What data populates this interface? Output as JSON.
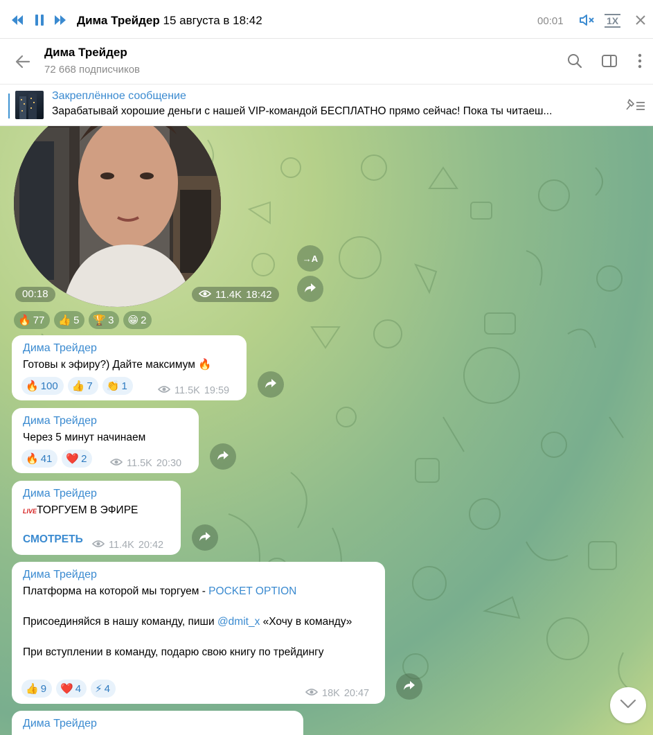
{
  "player": {
    "title_name": "Дима Трейдер",
    "title_date": "15 августа в 18:42",
    "time": "00:01",
    "speed": "1X"
  },
  "header": {
    "name": "Дима Трейдер",
    "subscribers": "72 668 подписчиков"
  },
  "pinned": {
    "title": "Закреплённое сообщение",
    "text_bold": "Зарабатывай хорошие деньги с нашей VIP-командой БЕСПЛАТНО прямо сейчас!",
    "text_rest": " Пока ты читаеш..."
  },
  "video": {
    "duration": "00:18",
    "views": "11.4K",
    "time": "18:42",
    "translate_label": "→A",
    "reactions": [
      {
        "emoji": "🔥",
        "count": "77"
      },
      {
        "emoji": "👍",
        "count": "5"
      },
      {
        "emoji": "🏆",
        "count": "3"
      },
      {
        "emoji": "😁",
        "count": "2"
      }
    ]
  },
  "messages": [
    {
      "author": "Дима Трейдер",
      "text": "Готовы к эфиру?) Дайте максимум 🔥",
      "reactions": [
        {
          "emoji": "🔥",
          "count": "100"
        },
        {
          "emoji": "👍",
          "count": "7"
        },
        {
          "emoji": "👏",
          "count": "1"
        }
      ],
      "views": "11.5K",
      "time": "19:59"
    },
    {
      "author": "Дима Трейдер",
      "text": "Через 5 минут начинаем",
      "reactions": [
        {
          "emoji": "🔥",
          "count": "41"
        },
        {
          "emoji": "❤️",
          "count": "2"
        }
      ],
      "views": "11.5K",
      "time": "20:30"
    },
    {
      "author": "Дима Трейдер",
      "live_badge": "LIVE",
      "text": "ТОРГУЕМ В ЭФИРЕ",
      "link": "СМОТРЕТЬ",
      "views": "11.4K",
      "time": "20:42"
    },
    {
      "author": "Дима Трейдер",
      "line1_text": "Платформа на которой мы торгуем - ",
      "line1_link": "POCKET OPTION",
      "line2_text": "Присоединяйся в нашу команду, пиши ",
      "line2_link": "@dmit_x",
      "line2_rest": " «Хочу в команду»",
      "line3_text": "При вступлении в команду, подарю свою книгу по трейдингу",
      "reactions": [
        {
          "emoji": "👍",
          "count": "9"
        },
        {
          "emoji": "❤️",
          "count": "4"
        },
        {
          "emoji": "⚡",
          "count": "4"
        }
      ],
      "views": "18K",
      "time": "20:47"
    },
    {
      "author": "Дима Трейдер"
    }
  ]
}
